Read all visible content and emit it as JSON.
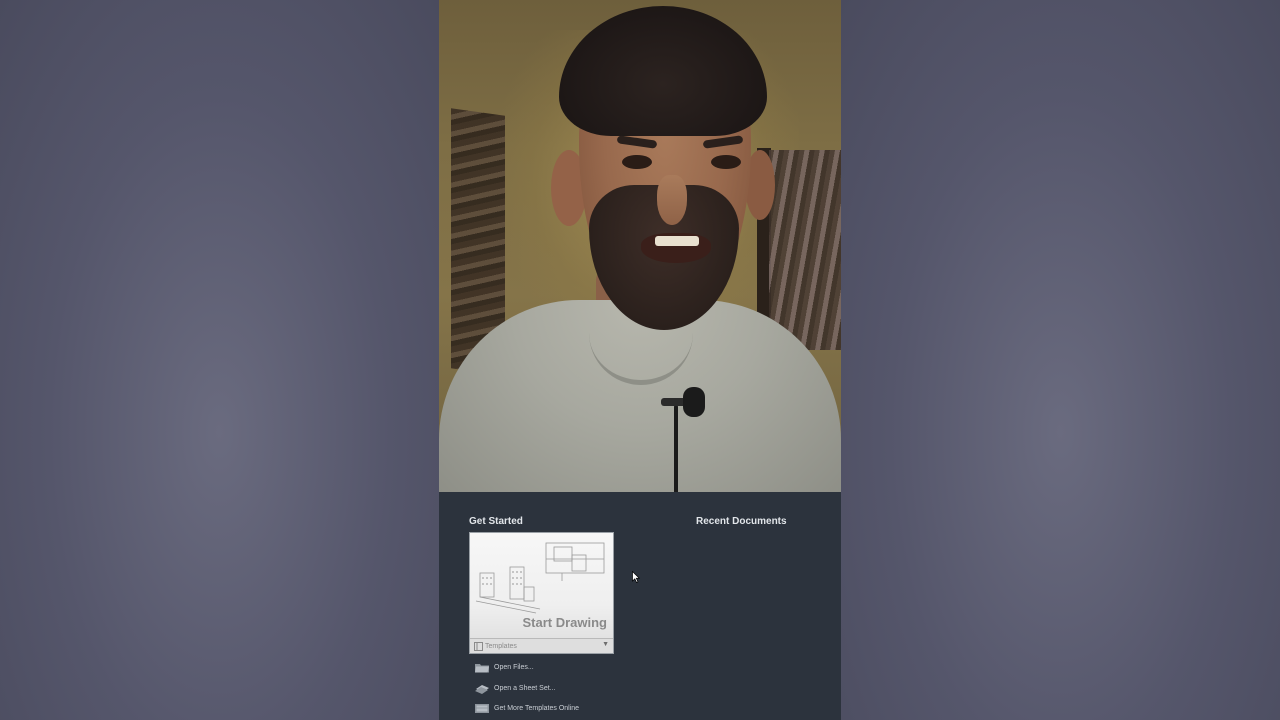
{
  "start_panel": {
    "get_started_title": "Get Started",
    "recent_documents_title": "Recent Documents",
    "start_card": {
      "label": "Start Drawing",
      "templates_label": "Templates"
    },
    "links": [
      {
        "label": "Open Files...",
        "icon": "folder-icon"
      },
      {
        "label": "Open a Sheet Set...",
        "icon": "sheet-set-icon"
      },
      {
        "label": "Get More Templates Online",
        "icon": "templates-online-icon"
      }
    ]
  },
  "colors": {
    "panel_bg": "#2c333d",
    "title_text": "#e2e6ea",
    "link_text": "#c9ced4"
  }
}
